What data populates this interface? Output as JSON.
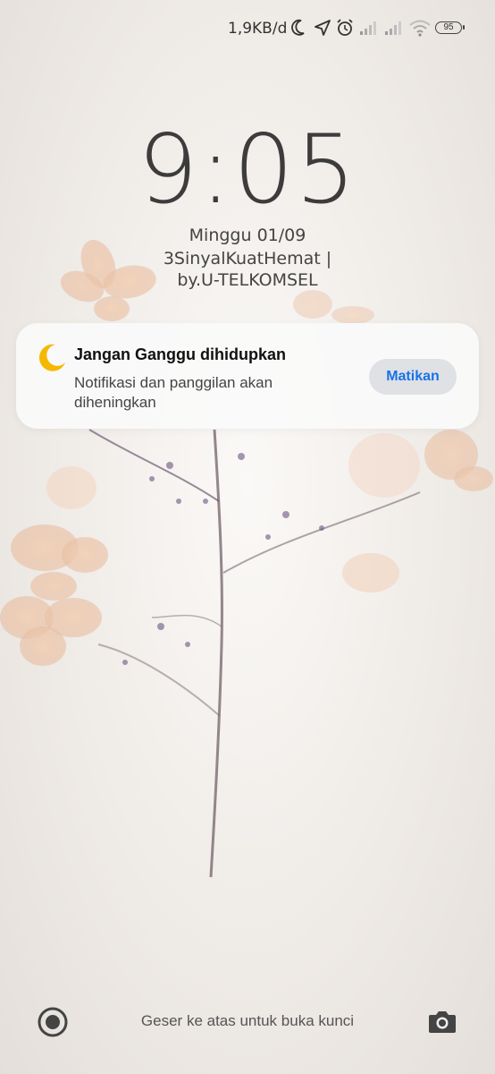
{
  "status_bar": {
    "network_speed": "1,9KB/d",
    "battery_level": "95",
    "icons": [
      "moon-icon",
      "location-arrow-icon",
      "alarm-icon",
      "signal-1-icon",
      "signal-2-icon",
      "wifi-icon",
      "battery-icon"
    ]
  },
  "lockscreen": {
    "time": "9:05",
    "date": "Minggu 01/09",
    "carrier_line1": "3SinyalKuatHemat |",
    "carrier_line2": "by.U-TELKOMSEL"
  },
  "notification": {
    "icon": "moon-icon",
    "title": "Jangan Ganggu dihidupkan",
    "body": "Notifikasi dan panggilan akan diheningkan",
    "action_label": "Matikan",
    "icon_color": "#f5b800",
    "action_color": "#1a73e8"
  },
  "bottom": {
    "hint": "Geser ke atas untuk buka kunci",
    "left_icon": "record-icon",
    "right_icon": "camera-icon"
  }
}
